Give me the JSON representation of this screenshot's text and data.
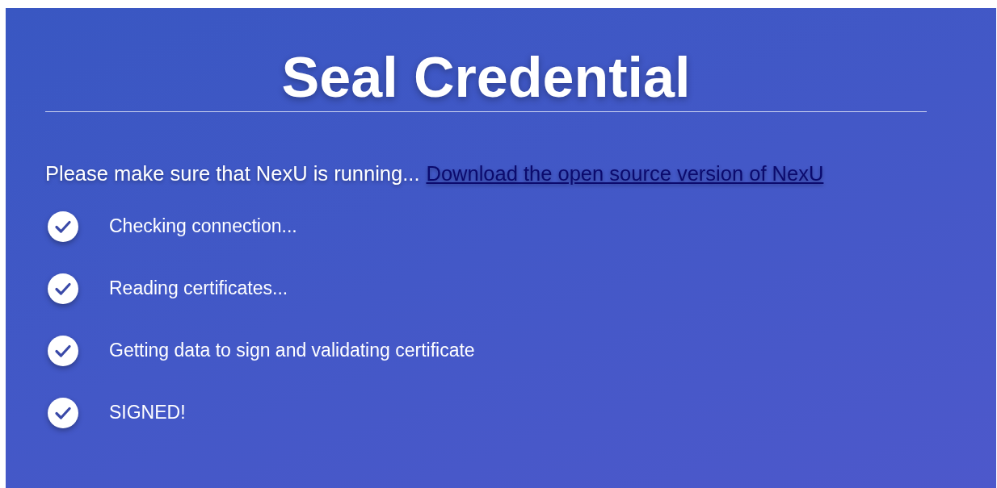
{
  "title": "Seal Credential",
  "notice": {
    "text": "Please make sure that NexU is running...",
    "link": "Download the open source version of NexU"
  },
  "steps": [
    {
      "label": "Checking connection...",
      "done": true
    },
    {
      "label": "Reading certificates...",
      "done": true
    },
    {
      "label": "Getting data to sign and validating certificate",
      "done": true
    },
    {
      "label": "SIGNED!",
      "done": true
    }
  ]
}
